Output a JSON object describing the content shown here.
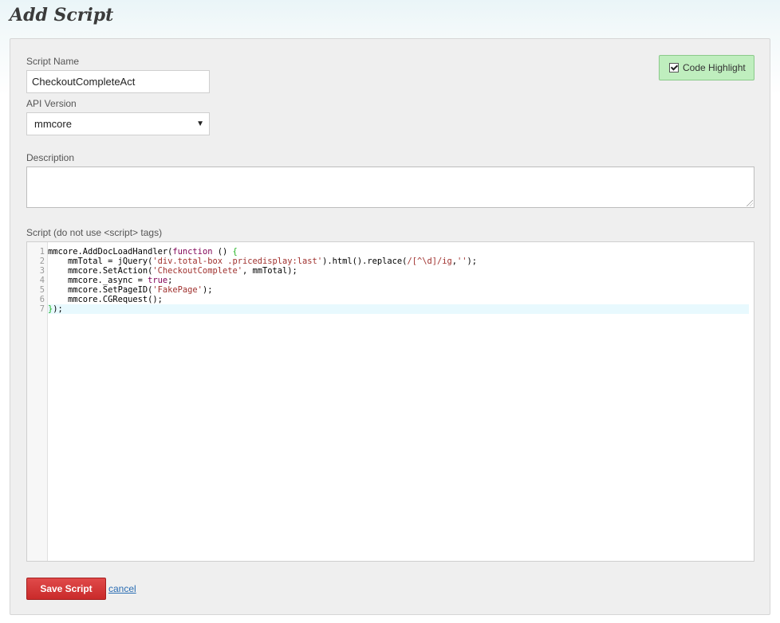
{
  "page": {
    "title": "Add Script"
  },
  "form": {
    "script_name": {
      "label": "Script Name",
      "value": "CheckoutCompleteAct"
    },
    "api_version": {
      "label": "API Version",
      "selected": "mmcore"
    },
    "description": {
      "label": "Description",
      "value": ""
    },
    "script": {
      "label": "Script (do not use <script> tags)",
      "line_numbers": [
        "1",
        "2",
        "3",
        "4",
        "5",
        "6",
        "7"
      ]
    },
    "code_highlight": {
      "label": "Code Highlight",
      "checked": true
    }
  },
  "actions": {
    "save_label": "Save Script",
    "cancel_label": "cancel"
  },
  "icons": {
    "select_arrow": "dropdown-arrow-icon",
    "checkbox": "checkbox-icon"
  },
  "colors": {
    "save_button": "#d33333",
    "highlight_button": "#bfeebe",
    "link": "#2a6db3",
    "code_keyword": "#7f0055",
    "code_string": "#a0312e",
    "code_bracket": "#22b422"
  }
}
